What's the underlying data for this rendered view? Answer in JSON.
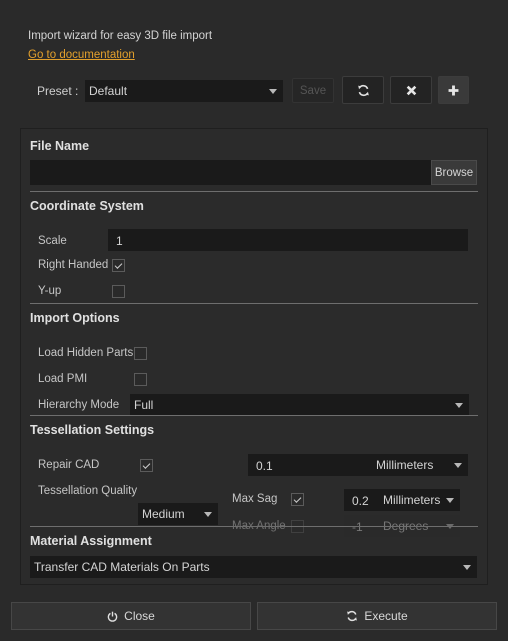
{
  "header": {
    "intro": "Import wizard for easy 3D file import",
    "doc_link": "Go to documentation"
  },
  "preset": {
    "label": "Preset :",
    "selected": "Default",
    "save_label": "Save"
  },
  "file_name": {
    "title": "File Name",
    "value": "",
    "browse_label": "Browse"
  },
  "coordinate_system": {
    "title": "Coordinate System",
    "scale_label": "Scale",
    "scale_value": "1",
    "right_handed_label": "Right Handed",
    "right_handed": true,
    "yup_label": "Y-up",
    "yup": false
  },
  "import_options": {
    "title": "Import Options",
    "load_hidden_label": "Load Hidden Parts",
    "load_hidden": false,
    "load_pmi_label": "Load PMI",
    "load_pmi": false,
    "hierarchy_label": "Hierarchy Mode",
    "hierarchy_value": "Full"
  },
  "tessellation": {
    "title": "Tessellation Settings",
    "repair_label": "Repair CAD",
    "repair": true,
    "tolerance_value": "0.1",
    "tolerance_unit": "Millimeters",
    "quality_label": "Tessellation Quality",
    "quality_value": "Medium",
    "max_sag_label": "Max Sag",
    "max_sag_enabled": true,
    "max_sag_value": "0.2",
    "max_sag_unit": "Millimeters",
    "max_angle_label": "Max Angle",
    "max_angle_enabled": false,
    "max_angle_value": "-1",
    "max_angle_unit": "Degrees"
  },
  "material": {
    "title": "Material Assignment",
    "value": "Transfer CAD Materials On Parts"
  },
  "footer": {
    "close_label": "Close",
    "execute_label": "Execute"
  }
}
